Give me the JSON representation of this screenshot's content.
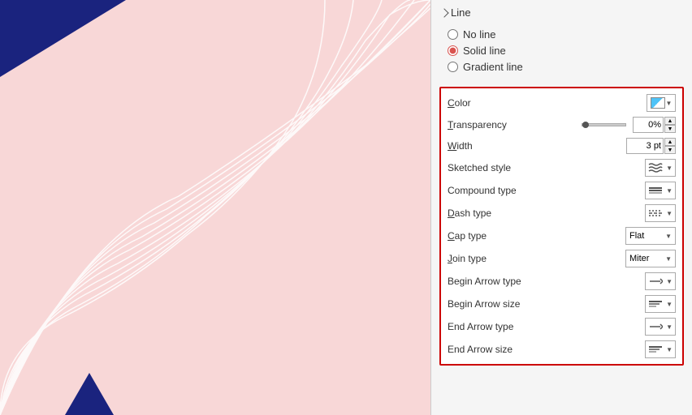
{
  "canvas": {
    "background_color": "#f8d7d7"
  },
  "panel": {
    "section_label": "Line",
    "radio_options": [
      {
        "id": "no-line",
        "label": "No line",
        "checked": false
      },
      {
        "id": "solid-line",
        "label": "Solid line",
        "checked": true
      },
      {
        "id": "gradient-line",
        "label": "Gradient line",
        "checked": false
      }
    ],
    "properties": {
      "color": {
        "label": "Color",
        "underline_char": "C"
      },
      "transparency": {
        "label": "Transparency",
        "value": "0%",
        "underline_char": "T"
      },
      "width": {
        "label": "Width",
        "value": "3 pt",
        "underline_char": "W"
      },
      "sketched_style": {
        "label": "Sketched style",
        "underline_char": "S"
      },
      "compound_type": {
        "label": "Compound type",
        "underline_char": "C"
      },
      "dash_type": {
        "label": "Dash type",
        "underline_char": "D"
      },
      "cap_type": {
        "label": "Cap type",
        "value": "Flat",
        "underline_char": "C"
      },
      "join_type": {
        "label": "Join type",
        "value": "Miter",
        "underline_char": "J"
      },
      "begin_arrow_type": {
        "label": "Begin Arrow type",
        "underline_char": "B"
      },
      "begin_arrow_size": {
        "label": "Begin Arrow size",
        "underline_char": "B"
      },
      "end_arrow_type": {
        "label": "End Arrow type",
        "underline_char": "E"
      },
      "end_arrow_size": {
        "label": "End Arrow size",
        "underline_char": "E"
      }
    }
  }
}
